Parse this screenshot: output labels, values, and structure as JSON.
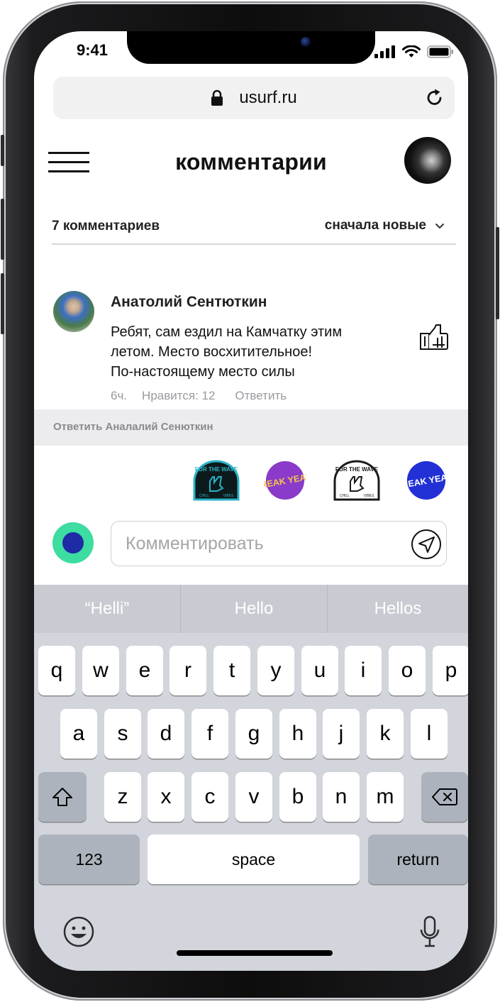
{
  "status_bar": {
    "time": "9:41"
  },
  "browser": {
    "url": "usurf.ru"
  },
  "header": {
    "title": "комментарии"
  },
  "comments_meta": {
    "count_label": "7 комментариев",
    "sort_label": "сначала новые"
  },
  "comment": {
    "author": "Анатолий Сентюткин",
    "lines": [
      "Ребят, сам ездил на Камчатку этим",
      "летом. Место восхитительное!",
      "По-настоящему место силы"
    ],
    "time": "6ч.",
    "likes_label": "Нравится: 12",
    "reply_label": "Ответить"
  },
  "reply_banner": {
    "text": "Ответить Аналалий Сенюткин"
  },
  "stickers": [
    {
      "name": "for-the-wave-teal",
      "top_text": "FOR THE WAVE",
      "bottom_left": "CHILL",
      "bottom_right": "VIBES",
      "color": "#2ab3c6"
    },
    {
      "name": "freak-yeah-purple",
      "text": "FREAK YEAH!",
      "color": "#8a3bc9",
      "text_color": "#f6c64a"
    },
    {
      "name": "for-the-wave-black",
      "top_text": "FOR THE WAVE",
      "bottom_left": "CHILL",
      "bottom_right": "VIBES",
      "color": "#1a1a1a"
    },
    {
      "name": "freak-yeah-blue",
      "text": "FREAK YEAH!",
      "color": "#2230d6",
      "text_color": "#ffffff"
    }
  ],
  "composer": {
    "placeholder": "Комментировать",
    "value": ""
  },
  "keyboard": {
    "suggestions": [
      "“Helli”",
      "Hello",
      "Hellos"
    ],
    "row1": [
      "q",
      "w",
      "e",
      "r",
      "t",
      "y",
      "u",
      "i",
      "o",
      "p"
    ],
    "row2": [
      "a",
      "s",
      "d",
      "f",
      "g",
      "h",
      "j",
      "k",
      "l"
    ],
    "row3": [
      "z",
      "x",
      "c",
      "v",
      "b",
      "n",
      "m"
    ],
    "numbers_label": "123",
    "space_label": "space",
    "return_label": "return"
  },
  "colors": {
    "my_avatar_ring": "#3ddca0",
    "my_avatar_center": "#1e2aa6"
  }
}
